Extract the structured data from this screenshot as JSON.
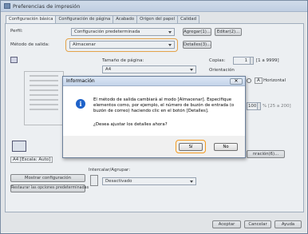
{
  "window": {
    "title": "Preferencias de impresión"
  },
  "tabs": [
    {
      "label": "Configuración básica",
      "active": true
    },
    {
      "label": "Configuración de página"
    },
    {
      "label": "Acabado"
    },
    {
      "label": "Origen del papel"
    },
    {
      "label": "Calidad"
    }
  ],
  "profile": {
    "label": "Perfil:",
    "value": "Configuración predeterminada",
    "add_button": "Agregar(1)...",
    "edit_button": "Editar(2)..."
  },
  "output_method": {
    "label": "Método de salida:",
    "value": "Almacenar",
    "details_button": "Detalles(3)..."
  },
  "page_size": {
    "label": "Tamaño de página:",
    "value": "A4"
  },
  "copies": {
    "label": "Copias:",
    "value": "1",
    "range": "[1 a 9999]"
  },
  "orientation": {
    "label": "Orientación",
    "option": "Horizontal",
    "icon_letter": "A"
  },
  "scale": {
    "value": "100",
    "range": "% [25 a 200]"
  },
  "preview_caption": "A4 [Escala: Auto]",
  "left_buttons": {
    "show_config": "Mostrar configuración",
    "restore": "Restaurar las opciones predeterminadas"
  },
  "collate": {
    "label": "Intercalar/Agrupar:",
    "value": "Desactivado"
  },
  "partial_button": "nración(6)...",
  "footer": {
    "accept": "Aceptar",
    "cancel": "Cancelar",
    "help": "Ayuda"
  },
  "dialog": {
    "title": "Información",
    "message": "El método de salida cambiará al modo [Almacenar]. Especifique elementos como, por ejemplo, el número de buzón de entrada (o buzón de correo) haciendo clic en el botón [Detalles].",
    "question": "¿Desea ajustar los detalles ahora?",
    "yes": "Sí",
    "no": "No"
  },
  "colors": {
    "highlight": "#f39a1e",
    "info_icon": "#1e62c9"
  }
}
